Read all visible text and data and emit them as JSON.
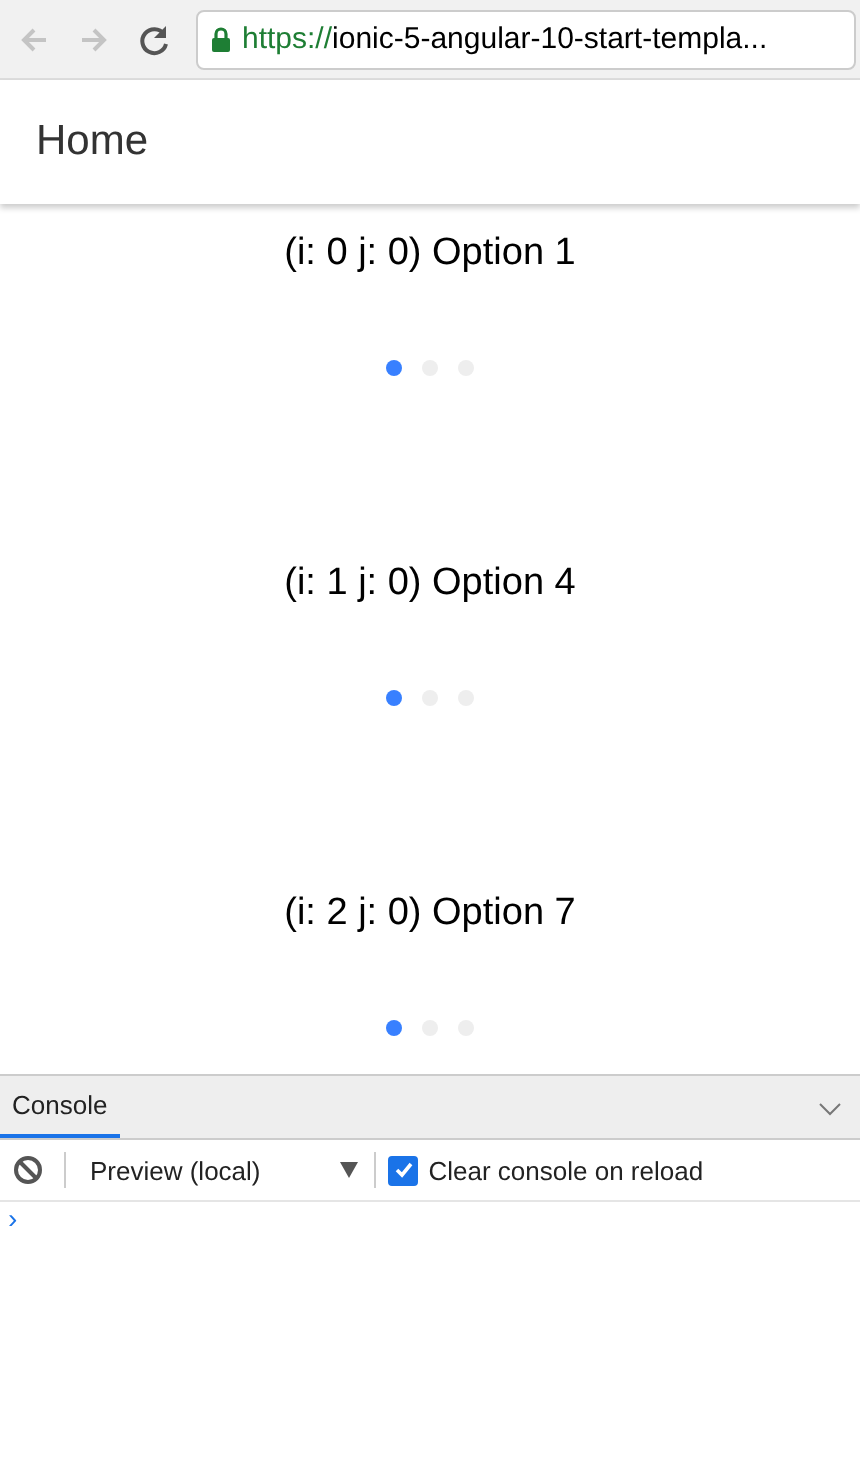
{
  "browser": {
    "url_scheme": "https://",
    "url_rest": "ionic-5-angular-10-start-templa..."
  },
  "header": {
    "title": "Home"
  },
  "slides": [
    {
      "label": "(i: 0 j: 0) Option 1",
      "pages": [
        {
          "selected": true
        },
        {
          "selected": false
        },
        {
          "selected": false
        }
      ]
    },
    {
      "label": "(i: 1 j: 0) Option 4",
      "pages": [
        {
          "selected": true
        },
        {
          "selected": false
        },
        {
          "selected": false
        }
      ]
    },
    {
      "label": "(i: 2 j: 0) Option 7",
      "pages": [
        {
          "selected": true
        },
        {
          "selected": false
        },
        {
          "selected": false
        }
      ]
    }
  ],
  "console": {
    "tab": "Console",
    "context": "Preview (local)",
    "clear_on_reload": {
      "label": "Clear console on reload",
      "checked": true
    },
    "prompt": "›"
  }
}
